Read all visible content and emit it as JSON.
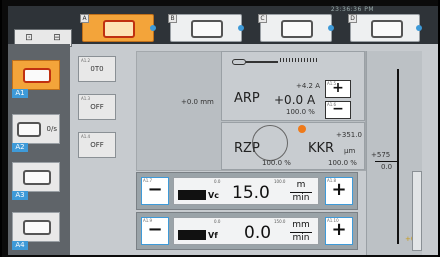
{
  "status_bar": {
    "clock": "23:36:36 PM"
  },
  "tabs": [
    {
      "letter": "A",
      "active": true
    },
    {
      "letter": "B",
      "active": false
    },
    {
      "letter": "C",
      "active": false
    },
    {
      "letter": "D",
      "active": false
    }
  ],
  "sidebar": {
    "items": [
      {
        "label": "A1",
        "text": "",
        "active": true
      },
      {
        "label": "A2",
        "text": "0/s",
        "active": false
      },
      {
        "label": "A3",
        "text": "",
        "active": false
      },
      {
        "label": "A4",
        "text": "",
        "active": false
      }
    ]
  },
  "mid_buttons": [
    {
      "tag": "A1.2",
      "text": "0T0"
    },
    {
      "tag": "A1.3",
      "text": "OFF"
    },
    {
      "tag": "A1.4",
      "text": "OFF"
    }
  ],
  "arp": {
    "offset": "+0.0 mm",
    "label": "ARP",
    "value": "+0.0 A",
    "percent": "100.0 %",
    "delta": "+4.2 A",
    "plus_tag": "A1.5",
    "minus_tag": "A1.6"
  },
  "rzp": {
    "label": "RZP",
    "percent": "100.0 %"
  },
  "kkr": {
    "label": "KKR",
    "value": "+351.0",
    "unit": "µm",
    "percent": "100.0 %"
  },
  "right_scale": {
    "top_value": "+575",
    "zero": "0.0",
    "bottom_value": "+0",
    "bottom_zero": "0"
  },
  "vc_row": {
    "minus_tag": "A1.7",
    "plus_tag": "A1.8",
    "range_min": "0.0",
    "range_max": "100.0",
    "symbol": "Vc",
    "value": "15.0",
    "unit_num": "m",
    "unit_den": "min"
  },
  "vf_row": {
    "minus_tag": "A1.9",
    "plus_tag": "A1.10",
    "range_min": "0.0",
    "range_max": "150.0",
    "symbol": "Vf",
    "value": "0.0",
    "unit_num": "mm",
    "unit_den": "min"
  },
  "colors": {
    "accent": "#f3a43a",
    "highlight": "#3e9ad8",
    "alert": "#ef7a1a"
  }
}
